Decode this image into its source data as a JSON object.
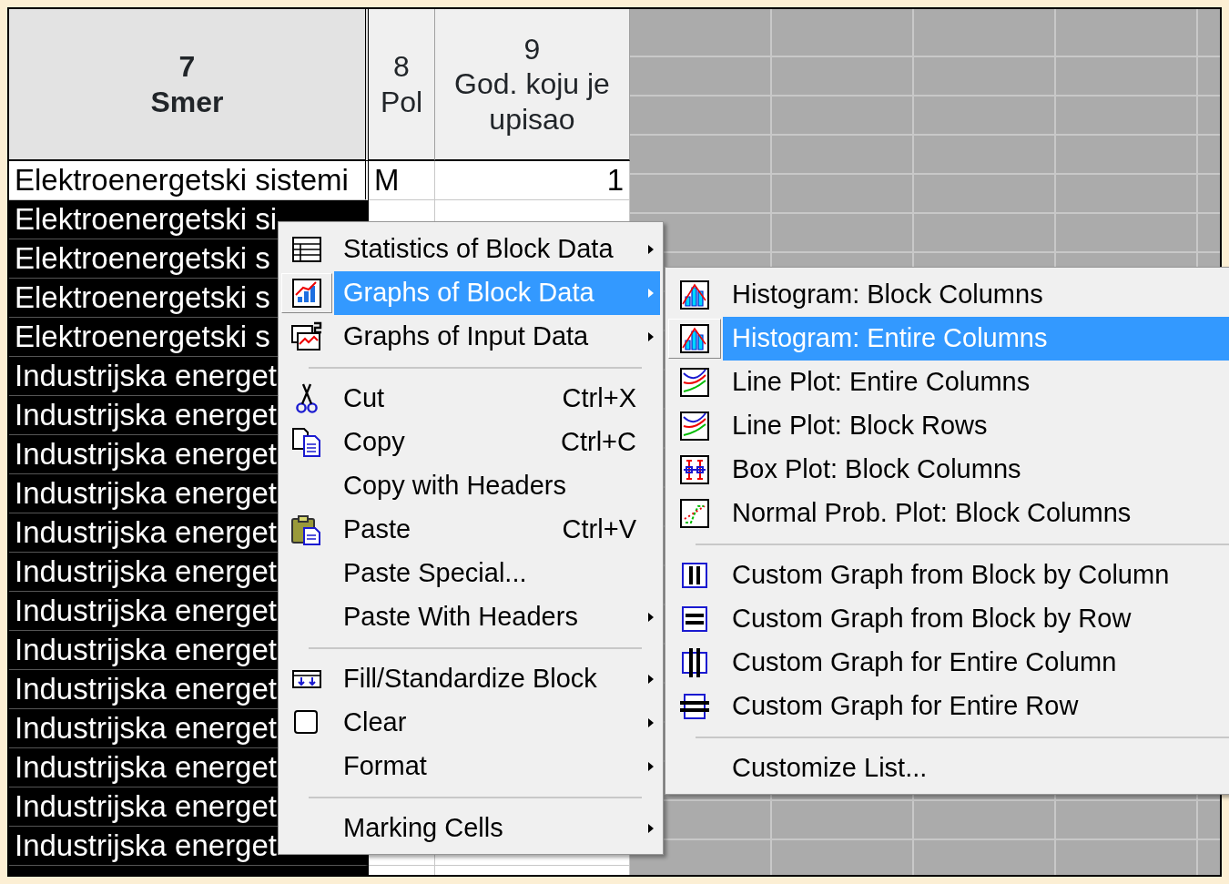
{
  "sheet": {
    "columns": [
      {
        "number": "7",
        "name": "Smer",
        "selected": true
      },
      {
        "number": "8",
        "name": "Pol",
        "selected": false
      },
      {
        "number": "9",
        "name": "God. koju je upisao",
        "selected": false
      }
    ],
    "rows": [
      {
        "smer": "Elektroenergetski sistemi",
        "pol": "M",
        "god": "1",
        "selected": false
      },
      {
        "smer": "Elektroenergetski si",
        "selected": true
      },
      {
        "smer": "Elektroenergetski s",
        "selected": true
      },
      {
        "smer": "Elektroenergetski s",
        "selected": true
      },
      {
        "smer": "Elektroenergetski s",
        "selected": true
      },
      {
        "smer": "Industrijska energet",
        "selected": true
      },
      {
        "smer": "Industrijska energet",
        "selected": true
      },
      {
        "smer": "Industrijska energet",
        "selected": true
      },
      {
        "smer": "Industrijska energet",
        "selected": true
      },
      {
        "smer": "Industrijska energet",
        "selected": true
      },
      {
        "smer": "Industrijska energet",
        "selected": true
      },
      {
        "smer": "Industrijska energet",
        "selected": true
      },
      {
        "smer": "Industrijska energet",
        "selected": true
      },
      {
        "smer": "Industrijska energet",
        "selected": true
      },
      {
        "smer": "Industrijska energet",
        "selected": true
      },
      {
        "smer": "Industrijska energet",
        "selected": true
      },
      {
        "smer": "Industrijska energet",
        "selected": true
      },
      {
        "smer": "Industrijska energet",
        "selected": true
      },
      {
        "selected": true
      }
    ]
  },
  "context_menu": {
    "items": [
      {
        "kind": "item",
        "label": "Statistics of Block Data",
        "submenu": true,
        "selected": false
      },
      {
        "kind": "item",
        "label": "Graphs of Block Data",
        "submenu": true,
        "selected": true
      },
      {
        "kind": "item",
        "label": "Graphs of Input Data",
        "submenu": true,
        "selected": false
      },
      {
        "kind": "separator"
      },
      {
        "kind": "item",
        "label": "Cut",
        "shortcut": "Ctrl+X",
        "submenu": false,
        "selected": false
      },
      {
        "kind": "item",
        "label": "Copy",
        "shortcut": "Ctrl+C",
        "submenu": false,
        "selected": false
      },
      {
        "kind": "item",
        "label": "Copy with Headers",
        "submenu": false,
        "selected": false
      },
      {
        "kind": "item",
        "label": "Paste",
        "shortcut": "Ctrl+V",
        "submenu": false,
        "selected": false
      },
      {
        "kind": "item",
        "label": "Paste Special...",
        "submenu": false,
        "selected": false
      },
      {
        "kind": "item",
        "label": "Paste With Headers",
        "submenu": true,
        "selected": false
      },
      {
        "kind": "separator"
      },
      {
        "kind": "item",
        "label": "Fill/Standardize Block",
        "submenu": true,
        "selected": false
      },
      {
        "kind": "item",
        "label": "Clear",
        "submenu": true,
        "selected": false
      },
      {
        "kind": "item",
        "label": "Format",
        "submenu": true,
        "selected": false
      },
      {
        "kind": "separator"
      },
      {
        "kind": "item",
        "label": "Marking Cells",
        "submenu": true,
        "selected": false
      }
    ]
  },
  "submenu": {
    "items": [
      {
        "kind": "item",
        "label": "Histogram: Block Columns",
        "selected": false
      },
      {
        "kind": "item",
        "label": "Histogram: Entire Columns",
        "selected": true
      },
      {
        "kind": "item",
        "label": "Line Plot: Entire Columns",
        "selected": false
      },
      {
        "kind": "item",
        "label": "Line Plot: Block Rows",
        "selected": false
      },
      {
        "kind": "item",
        "label": "Box Plot: Block Columns",
        "selected": false
      },
      {
        "kind": "item",
        "label": "Normal Prob. Plot: Block Columns",
        "selected": false
      },
      {
        "kind": "separator"
      },
      {
        "kind": "item",
        "label": "Custom Graph from Block by Column",
        "selected": false
      },
      {
        "kind": "item",
        "label": "Custom Graph from Block by Row",
        "selected": false
      },
      {
        "kind": "item",
        "label": "Custom Graph for Entire Column",
        "selected": false
      },
      {
        "kind": "item",
        "label": "Custom Graph for Entire Row",
        "selected": false
      },
      {
        "kind": "separator"
      },
      {
        "kind": "item",
        "label": "Customize List...",
        "selected": false
      }
    ]
  }
}
